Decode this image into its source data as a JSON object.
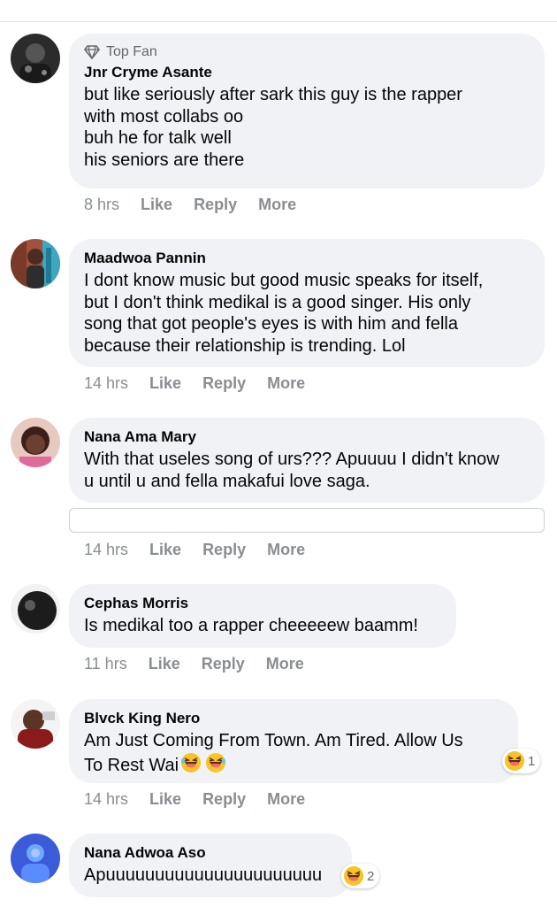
{
  "comments": [
    {
      "badge": "Top Fan",
      "name": "Jnr Cryme Asante",
      "text": "but like seriously after sark this guy is the rapper\nwith most collabs oo\nbuh he for talk well\nhis seniors are there",
      "time": "8 hrs",
      "like": "Like",
      "reply": "Reply",
      "more": "More"
    },
    {
      "name": "Maadwoa Pannin",
      "text": "I dont know music but good music speaks for itself,\nbut I don't think medikal is a good singer. His only\nsong that got people's eyes is with him and fella\nbecause their relationship is trending. Lol",
      "time": "14 hrs",
      "like": "Like",
      "reply": "Reply",
      "more": "More"
    },
    {
      "name": "Nana Ama Mary",
      "text": "With that useles song of urs??? Apuuuu I didn't know\nu until u and fella makafui love saga.",
      "time": "14 hrs",
      "like": "Like",
      "reply": "Reply",
      "more": "More"
    },
    {
      "name": "Cephas Morris",
      "text": "Is medikal too a rapper cheeeeew baamm!",
      "time": "11 hrs",
      "like": "Like",
      "reply": "Reply",
      "more": "More"
    },
    {
      "name": "Blvck King Nero",
      "text": "Am Just Coming From Town. Am Tired. Allow Us\nTo Rest Wai",
      "time": "14 hrs",
      "like": "Like",
      "reply": "Reply",
      "more": "More",
      "reaction_icon": "laughing-emoji-icon",
      "reaction_count": "1"
    },
    {
      "name": "Nana Adwoa Aso",
      "text": "Apuuuuuuuuuuuuuuuuuuuuuu",
      "reaction_icon": "laughing-emoji-icon",
      "reaction_count": "2"
    }
  ],
  "colors": {
    "bubble": "#f0f2f5",
    "muted": "#8a8d91",
    "text": "#050505"
  }
}
